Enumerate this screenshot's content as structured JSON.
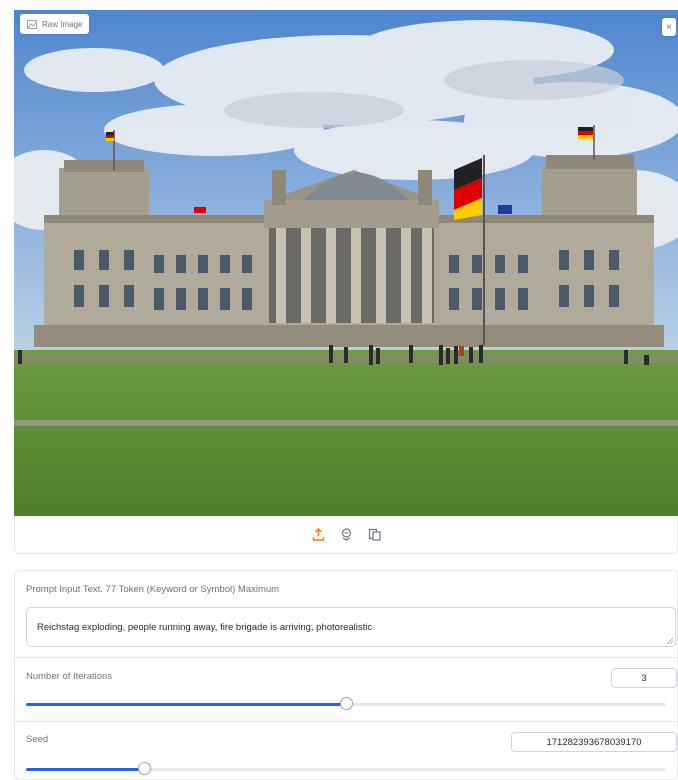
{
  "image_panel": {
    "label": "Raw Image",
    "close_symbol": "×"
  },
  "action_bar": {
    "icons": [
      "upload-icon",
      "share-icon",
      "copy-icon"
    ],
    "accent": "#f97316"
  },
  "form": {
    "prompt_label": "Prompt Input Text. 77 Token (Keyword or Symbol) Maximum",
    "prompt_value": "Reichstag exploding, people running away, fire brigade is arriving, photorealistic",
    "iterations_label": "Number of Iterations",
    "iterations_value": "3",
    "iterations_fraction": 0.5,
    "seed_label": "Seed",
    "seed_value": "171282393678039170",
    "seed_fraction": 0.185
  },
  "colors": {
    "slider_fill": "#2563eb",
    "border": "#e5e7eb"
  }
}
